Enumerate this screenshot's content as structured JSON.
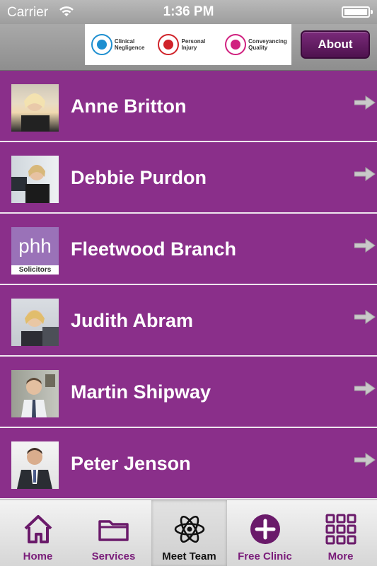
{
  "status_bar": {
    "carrier": "Carrier",
    "time": "1:36 PM"
  },
  "header": {
    "accreditations": [
      {
        "line1": "Clinical",
        "line2": "Negligence",
        "color": "#1e8fd0"
      },
      {
        "line1": "Personal",
        "line2": "Injury",
        "color": "#d0232a"
      },
      {
        "line1": "Conveyancing",
        "line2": "Quality",
        "color": "#d0207f"
      }
    ],
    "about_label": "About"
  },
  "team": [
    {
      "name": "Anne Britton"
    },
    {
      "name": "Debbie Purdon"
    },
    {
      "name": "Fleetwood Branch",
      "logo_text": "phh",
      "logo_sub": "Solicitors"
    },
    {
      "name": "Judith Abram"
    },
    {
      "name": "Martin Shipway"
    },
    {
      "name": "Peter Jenson"
    }
  ],
  "tabs": [
    {
      "label": "Home",
      "icon": "home-icon"
    },
    {
      "label": "Services",
      "icon": "folder-icon"
    },
    {
      "label": "Meet Team",
      "icon": "atom-icon",
      "active": true
    },
    {
      "label": "Free Clinic",
      "icon": "plus-circle-icon"
    },
    {
      "label": "More",
      "icon": "grid-icon"
    }
  ],
  "colors": {
    "brand_purple": "#8a2f8a",
    "tab_label": "#7a1d7a"
  }
}
